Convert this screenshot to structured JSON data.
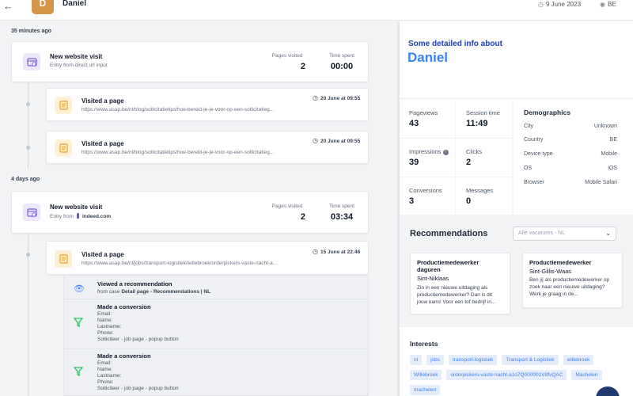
{
  "header": {
    "back_icon": "arrow-left-icon",
    "avatar_letter": "D",
    "user_name": "Daniel",
    "date": "9 June 2023",
    "country": "BE",
    "avatar_color": "#d69548"
  },
  "timeline": {
    "groups": [
      {
        "time_ago": "35 minutes ago",
        "visit": {
          "title": "New website visit",
          "subtitle": "Entry from direct url input",
          "pages_label": "Pages visited",
          "pages_value": "2",
          "time_label": "Time spent",
          "time_value": "00:00"
        },
        "pages": [
          {
            "title": "Visited a page",
            "url": "https://www.asap.be/nl/blog/sollicitatietips/hoe-bereid-je-je-voor-op-een-sollicitatieg...",
            "date": "20 June at 09:55"
          },
          {
            "title": "Visited a page",
            "url": "https://www.asap.be/nl/blog/sollicitatietips/hoe-bereid-je-je-voor-op-een-sollicitatieg...",
            "date": "20 June at 09:55"
          }
        ]
      },
      {
        "time_ago": "4 days ago",
        "visit": {
          "title": "New website visit",
          "subtitle_prefix": "Entry from",
          "subtitle_source": "indeed.com",
          "pages_label": "Pages visited",
          "pages_value": "2",
          "time_label": "Time spent",
          "time_value": "03:34"
        },
        "pages": [
          {
            "title": "Visited a page",
            "url": "https://www.asap.be/nl/jobs/transport-logistiek/willebroek/orderpickers-vaste-nacht-a...",
            "date": "15 June at 22:46"
          }
        ],
        "events": {
          "recommendation": {
            "title": "Viewed a recommendation",
            "from_prefix": "from case",
            "case_name": "Detail page - Recommendations | NL"
          },
          "conversions": [
            {
              "title": "Made a conversion",
              "fields": [
                "Email:",
                "Name:",
                "Lastname:",
                "Phone:"
              ],
              "source": "Solliciteer - job page - popup button"
            },
            {
              "title": "Made a conversion",
              "fields": [
                "Email:",
                "Name:",
                "Lastname:",
                "Phone:"
              ],
              "source": "Solliciteer - job page - popup button"
            }
          ]
        }
      }
    ]
  },
  "info": {
    "heading": "Some detailed info about",
    "name": "Daniel",
    "stats": [
      {
        "label": "Pageviews",
        "value": "43"
      },
      {
        "label": "Session time",
        "value": "11:49"
      },
      {
        "label": "Impressions",
        "value": "39"
      },
      {
        "label": "Clicks",
        "value": "2"
      },
      {
        "label": "Conversions",
        "value": "3"
      },
      {
        "label": "Messages",
        "value": "0"
      }
    ],
    "demographics": {
      "title": "Demographics",
      "rows": [
        {
          "key": "City",
          "value": "Unknown"
        },
        {
          "key": "Country",
          "value": "BE"
        },
        {
          "key": "Device type",
          "value": "Mobile"
        },
        {
          "key": "OS",
          "value": "iOS"
        },
        {
          "key": "Browser",
          "value": "Mobile Safari"
        }
      ]
    }
  },
  "recommendations": {
    "title": "Recommendations",
    "select_placeholder": "Alle vacatures - NL",
    "cards": [
      {
        "title_line1": "Productiemedewerker",
        "title_line2": "daguren",
        "place": "Sint-Niklaas",
        "desc": [
          "Zin in een nieuwe uitdaging als",
          "productiemedewerker? Dan is dit",
          "jouw kans! Voor een tof bedrijf in..."
        ]
      },
      {
        "title_line1": "Productiemedewerker",
        "place": "Sint-Gillis-Waas",
        "desc": [
          "Ben jij als productiemedewerker op",
          "zoek naar een nieuwe uitdaging?",
          "Werk je graag in de..."
        ]
      }
    ]
  },
  "interests": {
    "title": "Interests",
    "tags": [
      "nl",
      "jobs",
      "transport-logistiek",
      "Transport & Logistiek",
      "willebroek",
      "Willebroek",
      "orderpickers-vaste-nacht-a1o7Q000001V8fvQAC",
      "Machelen",
      "machelen"
    ]
  },
  "colors": {
    "accent_blue": "#3b82f6",
    "purple_icon": "#7c5ce0",
    "amber_icon": "#e8a526",
    "green_funnel": "#22c55e"
  }
}
